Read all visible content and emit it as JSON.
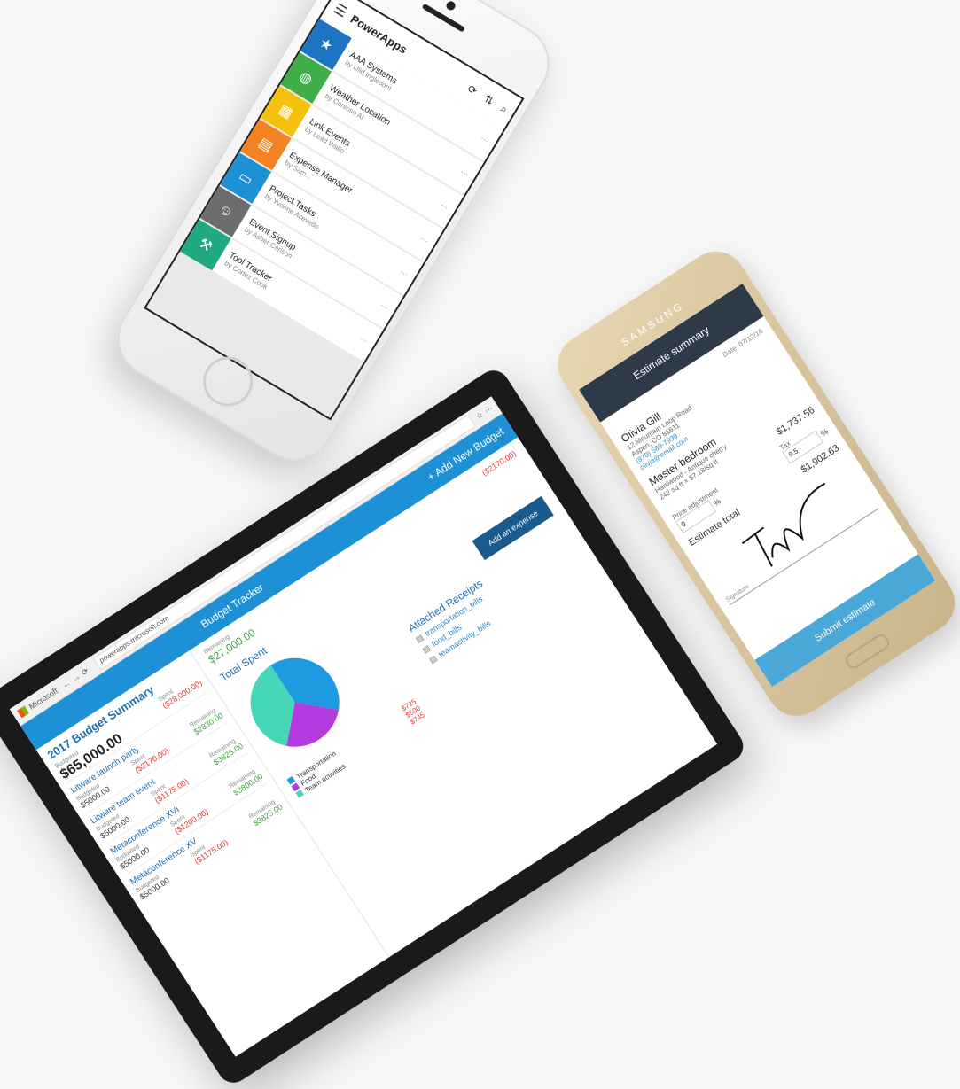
{
  "iphone": {
    "app_title": "PowerApps",
    "apps": [
      {
        "name": "AAA Systems",
        "by": "by Ulid Ingledom",
        "color": "#1e73c2",
        "icon": "star-icon"
      },
      {
        "name": "Weather Location",
        "by": "by Contoso AI",
        "color": "#3fae49",
        "icon": "globe-icon"
      },
      {
        "name": "Link Events",
        "by": "by Lead Wallo",
        "color": "#f4c20d",
        "icon": "grid-icon"
      },
      {
        "name": "Expense Manager",
        "by": "by Sam...",
        "color": "#f58220",
        "icon": "receipt-icon"
      },
      {
        "name": "Project Tasks",
        "by": "by Yvonne Acevedo",
        "color": "#1e90d6",
        "icon": "document-icon"
      },
      {
        "name": "Event Signup",
        "by": "by Asher Carlson",
        "color": "#6d6d6d",
        "icon": "person-icon"
      },
      {
        "name": "Tool Tracker",
        "by": "by Cortez Cook",
        "color": "#20a982",
        "icon": "tools-icon"
      }
    ]
  },
  "samsung": {
    "brand": "SAMSUNG",
    "header": "Estimate summary",
    "date": "Date: 07/12/16",
    "customer_name": "Olivia Gill",
    "address1": "12 Mountain Loop Road",
    "address2": "Aspen, CO 81611",
    "phone": "(970) 580-7999",
    "email": "olivia@email.com",
    "item_title": "Master bedroom",
    "item_desc1": "Hardwood - Antique cherry",
    "item_desc2": "242 sq ft × $7.18/sq ft",
    "item_amount": "$1,737.56",
    "price_adjustment_label": "Price adjustment",
    "price_adjustment_value": "0",
    "price_adjustment_unit": "%",
    "tax_label": "Tax",
    "tax_value": "9.5",
    "tax_unit": "%",
    "estimate_total_label": "Estimate total",
    "estimate_total": "$1,902.63",
    "signature_label": "Signature",
    "submit_label": "Submit estimate"
  },
  "tablet": {
    "browser_tab": "Microsoft",
    "url": "powerapps.microsoft.com",
    "app_title": "Budget Tracker",
    "add_budget_label": "+ Add New Budget",
    "summary_title": "2017 Budget Summary",
    "budgeted_label": "Budgeted",
    "budgeted_value": "$65,000.00",
    "spent_label": "Spent",
    "spent_value": "($28,000.00)",
    "remaining_label": "Remaining",
    "remaining_value": "$27,000.00",
    "right_spent": "($2170.00)",
    "events": [
      {
        "name": "Litware launch party",
        "budget": "$5000.00",
        "spent": "($2170.00)",
        "remaining": "$2830.00"
      },
      {
        "name": "Litware team event",
        "budget": "$5000.00",
        "spent": "($1175.00)",
        "remaining": "$3825.00"
      },
      {
        "name": "Metaconference XVI",
        "budget": "$5000.00",
        "spent": "($1200.00)",
        "remaining": "$3800.00"
      },
      {
        "name": "Metaconference XV",
        "budget": "$5000.00",
        "spent": "($1175.00)",
        "remaining": "$3825.00"
      }
    ],
    "total_spent_title": "Total Spent",
    "add_expense_label": "Add an expense",
    "legend": [
      {
        "label": "Transportation",
        "value": "$725",
        "color": "#1e9be0"
      },
      {
        "label": "Food",
        "value": "$500",
        "color": "#b33be0"
      },
      {
        "label": "Team activities",
        "value": "$745",
        "color": "#46d6b8"
      }
    ],
    "receipts_title": "Attached Receipts",
    "receipts": [
      "transportation_bills",
      "food_bills",
      "teamactivity_bills"
    ]
  },
  "colors": {
    "powerapps_blue": "#1e90d6",
    "estimate_header": "#2f3a48",
    "submit_blue": "#4aa8d8"
  }
}
